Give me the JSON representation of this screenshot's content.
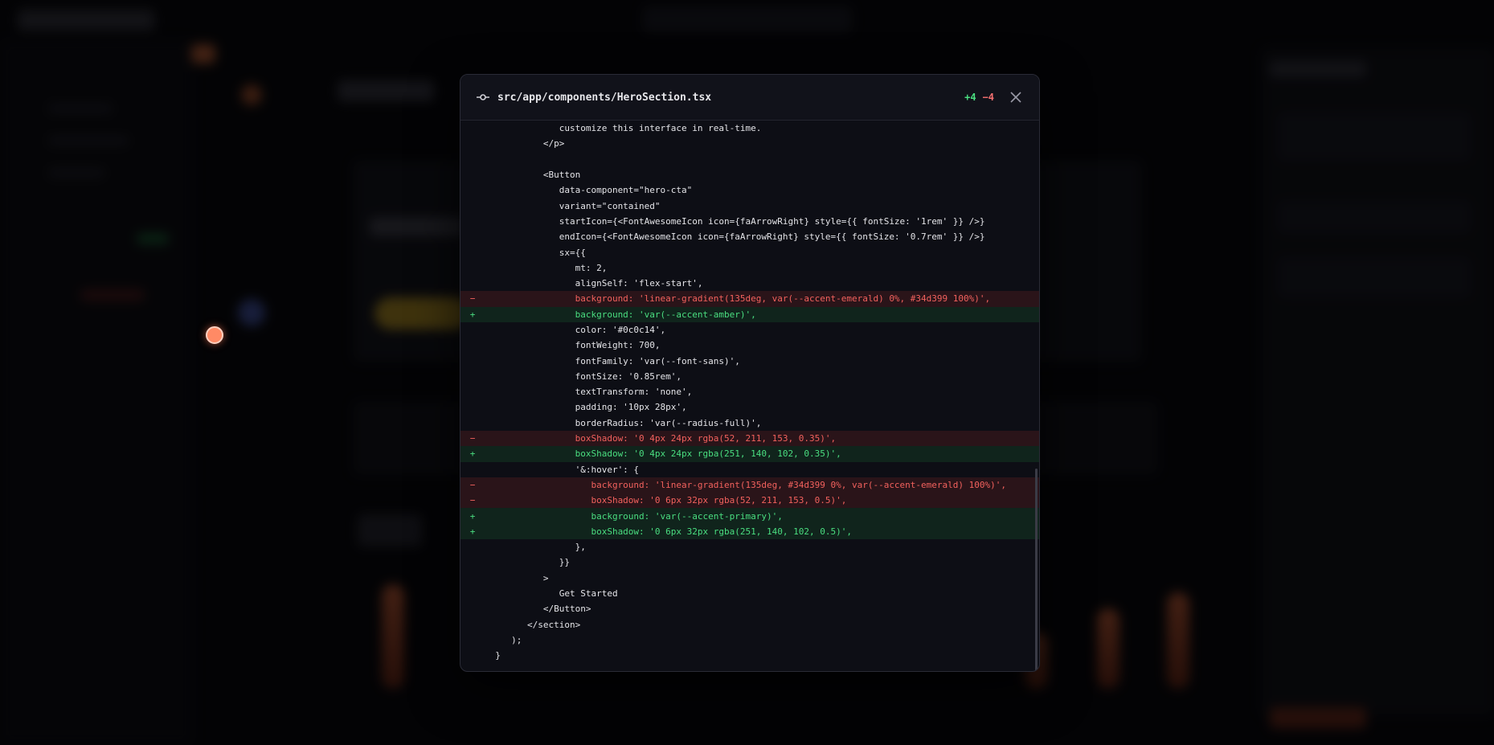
{
  "diff": {
    "file_path": "src/app/components/HeroSection.tsx",
    "additions": "+4",
    "deletions": "−4",
    "lines": [
      {
        "type": "ctx",
        "sign": "",
        "code": "              customize this interface in real-time."
      },
      {
        "type": "ctx",
        "sign": "",
        "code": "           </p>"
      },
      {
        "type": "ctx",
        "sign": "",
        "code": ""
      },
      {
        "type": "ctx",
        "sign": "",
        "code": "           <Button"
      },
      {
        "type": "ctx",
        "sign": "",
        "code": "              data-component=\"hero-cta\""
      },
      {
        "type": "ctx",
        "sign": "",
        "code": "              variant=\"contained\""
      },
      {
        "type": "ctx",
        "sign": "",
        "code": "              startIcon={<FontAwesomeIcon icon={faArrowRight} style={{ fontSize: '1rem' }} />}"
      },
      {
        "type": "ctx",
        "sign": "",
        "code": "              endIcon={<FontAwesomeIcon icon={faArrowRight} style={{ fontSize: '0.7rem' }} />}"
      },
      {
        "type": "ctx",
        "sign": "",
        "code": "              sx={{"
      },
      {
        "type": "ctx",
        "sign": "",
        "code": "                 mt: 2,"
      },
      {
        "type": "ctx",
        "sign": "",
        "code": "                 alignSelf: 'flex-start',"
      },
      {
        "type": "del",
        "sign": "−",
        "code": "                 background: 'linear-gradient(135deg, var(--accent-emerald) 0%, #34d399 100%)',"
      },
      {
        "type": "add",
        "sign": "+",
        "code": "                 background: 'var(--accent-amber)',"
      },
      {
        "type": "ctx",
        "sign": "",
        "code": "                 color: '#0c0c14',"
      },
      {
        "type": "ctx",
        "sign": "",
        "code": "                 fontWeight: 700,"
      },
      {
        "type": "ctx",
        "sign": "",
        "code": "                 fontFamily: 'var(--font-sans)',"
      },
      {
        "type": "ctx",
        "sign": "",
        "code": "                 fontSize: '0.85rem',"
      },
      {
        "type": "ctx",
        "sign": "",
        "code": "                 textTransform: 'none',"
      },
      {
        "type": "ctx",
        "sign": "",
        "code": "                 padding: '10px 28px',"
      },
      {
        "type": "ctx",
        "sign": "",
        "code": "                 borderRadius: 'var(--radius-full)',"
      },
      {
        "type": "del",
        "sign": "−",
        "code": "                 boxShadow: '0 4px 24px rgba(52, 211, 153, 0.35)',"
      },
      {
        "type": "add",
        "sign": "+",
        "code": "                 boxShadow: '0 4px 24px rgba(251, 140, 102, 0.35)',"
      },
      {
        "type": "ctx",
        "sign": "",
        "code": "                 '&:hover': {"
      },
      {
        "type": "del",
        "sign": "−",
        "code": "                    background: 'linear-gradient(135deg, #34d399 0%, var(--accent-emerald) 100%)',"
      },
      {
        "type": "del",
        "sign": "−",
        "code": "                    boxShadow: '0 6px 32px rgba(52, 211, 153, 0.5)',"
      },
      {
        "type": "add",
        "sign": "+",
        "code": "                    background: 'var(--accent-primary)',"
      },
      {
        "type": "add",
        "sign": "+",
        "code": "                    boxShadow: '0 6px 32px rgba(251, 140, 102, 0.5)',"
      },
      {
        "type": "ctx",
        "sign": "",
        "code": "                 },"
      },
      {
        "type": "ctx",
        "sign": "",
        "code": "              }}"
      },
      {
        "type": "ctx",
        "sign": "",
        "code": "           >"
      },
      {
        "type": "ctx",
        "sign": "",
        "code": "              Get Started"
      },
      {
        "type": "ctx",
        "sign": "",
        "code": "           </Button>"
      },
      {
        "type": "ctx",
        "sign": "",
        "code": "        </section>"
      },
      {
        "type": "ctx",
        "sign": "",
        "code": "     );"
      },
      {
        "type": "ctx",
        "sign": "",
        "code": "  }"
      }
    ]
  },
  "colors": {
    "addition": "#4ade80",
    "deletion": "#f87171",
    "addition_bg": "#10241c",
    "deletion_bg": "#2a1419",
    "modal_bg": "#0d0e15"
  },
  "icons": {
    "header": "git-commit-icon",
    "close": "close-icon",
    "cursor": "cursor-dot"
  }
}
